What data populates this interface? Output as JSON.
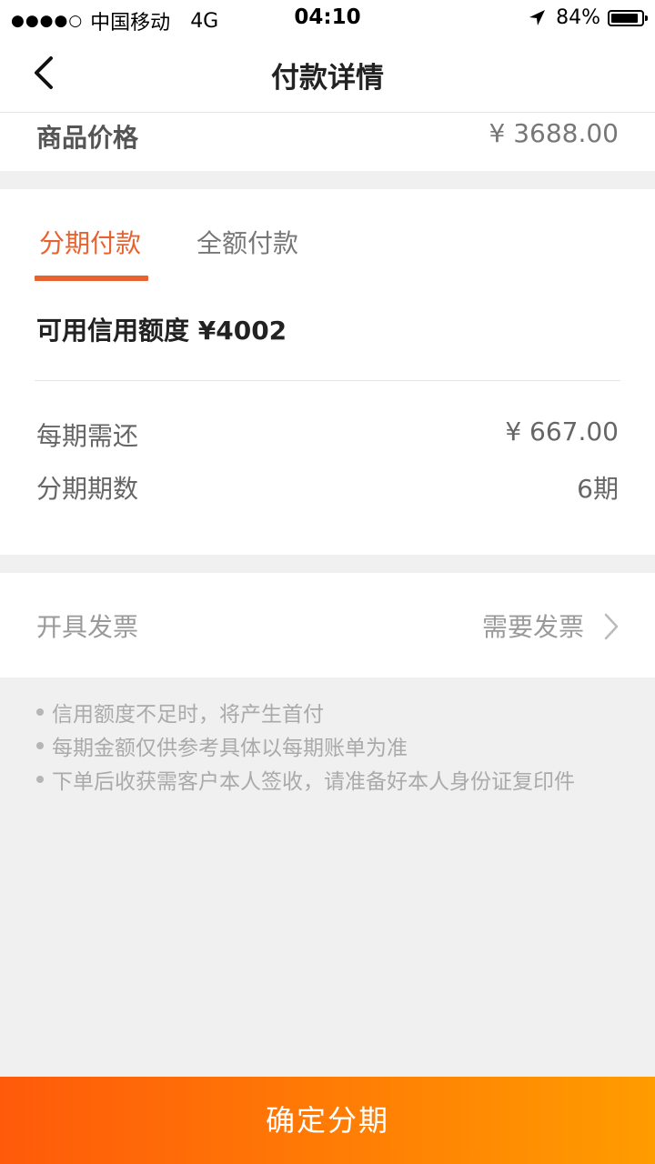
{
  "status_bar": {
    "signal_dots": "●●●●○",
    "carrier": "中国移动",
    "network": "4G",
    "time": "04:10",
    "battery_percent": "84%",
    "battery_level": 0.84,
    "icons": [
      "location-arrow-icon",
      "battery-icon"
    ]
  },
  "nav": {
    "title": "付款详情",
    "back_icon": "chevron-left-icon"
  },
  "product": {
    "label": "商品价格",
    "price": "¥ 3688.00"
  },
  "payment": {
    "tabs": [
      {
        "label": "分期付款",
        "active": true
      },
      {
        "label": "全额付款",
        "active": false
      }
    ],
    "credit_limit": "可用信用额度 ¥4002",
    "rows": [
      {
        "label": "每期需还",
        "value": "¥ 667.00"
      },
      {
        "label": "分期期数",
        "value": "6期"
      }
    ]
  },
  "invoice": {
    "label": "开具发票",
    "value": "需要发票",
    "icon": "chevron-right-icon"
  },
  "notes": [
    "信用额度不足时，将产生首付",
    "每期金额仅供参考具体以每期账单为准",
    "下单后收获需客户本人签收，请准备好本人身份证复印件"
  ],
  "confirm_button": "确定分期",
  "colors": {
    "accent": "#e8622f",
    "button_gradient_start": "#ff5a0a",
    "button_gradient_end": "#ff9c00",
    "background": "#f0f0f0"
  }
}
